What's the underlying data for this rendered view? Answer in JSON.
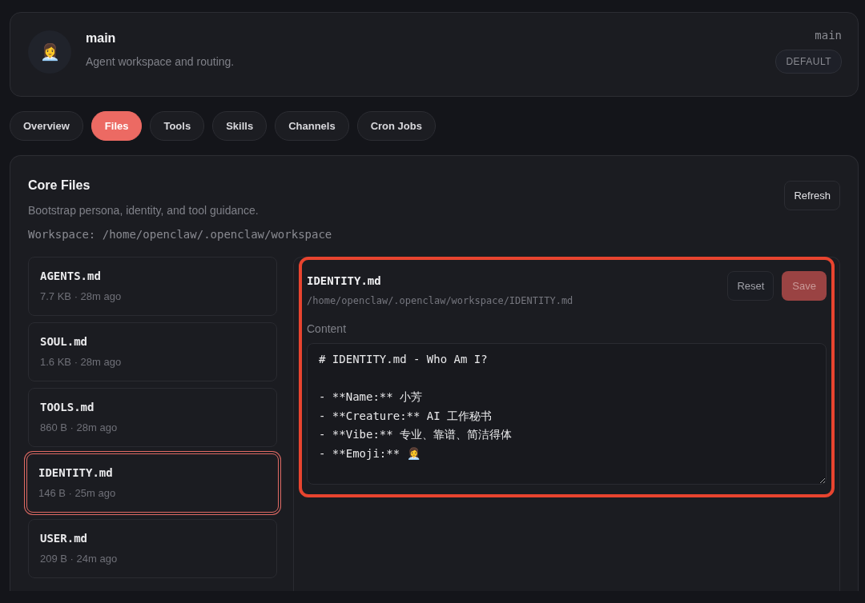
{
  "agent": {
    "avatar": "👩‍💼",
    "name": "main",
    "description": "Agent workspace and routing.",
    "id": "main",
    "badge": "DEFAULT"
  },
  "tabs": [
    {
      "label": "Overview",
      "selected": false
    },
    {
      "label": "Files",
      "selected": true
    },
    {
      "label": "Tools",
      "selected": false
    },
    {
      "label": "Skills",
      "selected": false
    },
    {
      "label": "Channels",
      "selected": false
    },
    {
      "label": "Cron Jobs",
      "selected": false
    }
  ],
  "core_files": {
    "title": "Core Files",
    "subtitle": "Bootstrap persona, identity, and tool guidance.",
    "workspace": "Workspace: /home/openclaw/.openclaw/workspace",
    "refresh_button": "Refresh",
    "files": [
      {
        "name": "AGENTS.md",
        "meta": "7.7 KB · 28m ago",
        "selected": false
      },
      {
        "name": "SOUL.md",
        "meta": "1.6 KB · 28m ago",
        "selected": false
      },
      {
        "name": "TOOLS.md",
        "meta": "860 B · 28m ago",
        "selected": false
      },
      {
        "name": "IDENTITY.md",
        "meta": "146 B · 25m ago",
        "selected": true
      },
      {
        "name": "USER.md",
        "meta": "209 B · 24m ago",
        "selected": false
      }
    ],
    "editor": {
      "highlighted": true,
      "file_name": "IDENTITY.md",
      "path": "/home/openclaw/.openclaw/workspace/IDENTITY.md",
      "reset_button": "Reset",
      "save_button": "Save",
      "save_disabled": true,
      "content_label": "Content",
      "content": "# IDENTITY.md - Who Am I?\n\n- **Name:** 小芳\n- **Creature:** AI 工作秘书\n- **Vibe:** 专业、靠谱、简洁得体\n- **Emoji:** 👩‍💼"
    }
  }
}
